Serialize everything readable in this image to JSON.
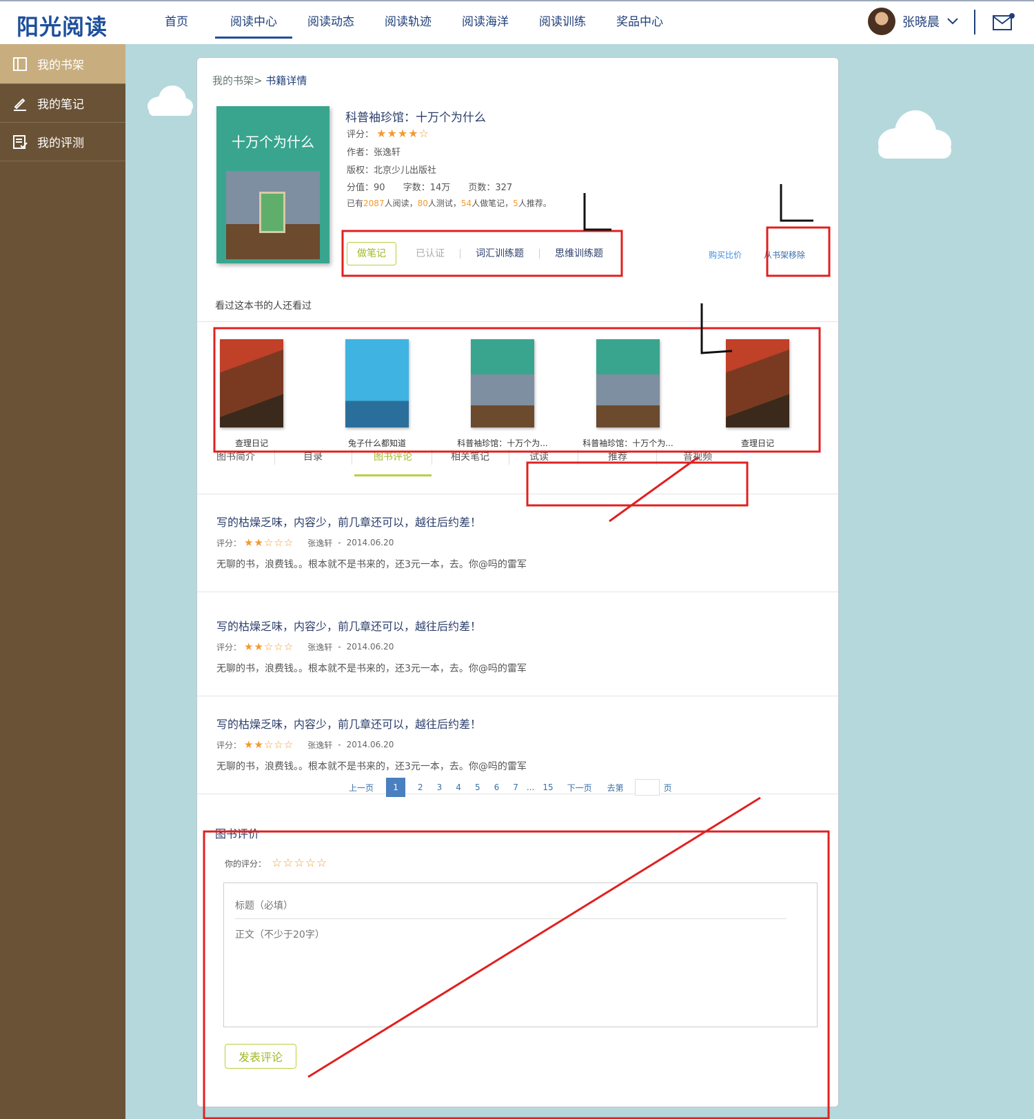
{
  "header": {
    "logo": "阳光阅读",
    "nav": [
      "首页",
      "阅读中心",
      "阅读动态",
      "阅读轨迹",
      "阅读海洋",
      "阅读训练",
      "奖品中心"
    ],
    "active_nav": "阅读中心",
    "user_name": "张晓晨"
  },
  "sidebar": {
    "items": [
      {
        "label": "我的书架",
        "icon": "bookshelf-icon"
      },
      {
        "label": "我的笔记",
        "icon": "pen-icon"
      },
      {
        "label": "我的评测",
        "icon": "checklist-icon"
      }
    ]
  },
  "breadcrumb": {
    "parent": "我的书架>",
    "current": "书籍详情"
  },
  "book": {
    "cover_title": "十万个为什么",
    "title": "科普袖珍馆：十万个为什么",
    "rating_label": "评分：",
    "rating": 4,
    "rating_max": 5,
    "author": "作者：张逸轩",
    "publisher": "版权：北京少儿出版社",
    "score": "分值：90",
    "words": "字数：14万",
    "pages": "页数：327",
    "stats": {
      "prefix": "已有",
      "readers": "2087",
      "readers_suffix": "人阅读，",
      "tested": "80",
      "tested_suffix": "人测试，",
      "notes": "54",
      "notes_suffix": "人做笔记，",
      "recommend": "5",
      "recommend_suffix": "人推荐。"
    },
    "actions": {
      "note": "做笔记",
      "certified": "已认证",
      "vocab": "词汇训练题",
      "thinking": "思维训练题",
      "buy": "购买比价",
      "remove": "从书架移除"
    }
  },
  "also_read": {
    "heading": "看过这本书的人还看过",
    "books": [
      {
        "label": "查理日记",
        "style": "diary"
      },
      {
        "label": "兔子什么都知道",
        "style": "rabbit"
      },
      {
        "label": "科普袖珍馆：十万个为...",
        "style": "sci"
      },
      {
        "label": "科普袖珍馆：十万个为...",
        "style": "sci"
      },
      {
        "label": "查理日记",
        "style": "diary"
      }
    ]
  },
  "tabs": [
    "图书简介",
    "目录",
    "图书评论",
    "相关笔记",
    "试读",
    "推荐",
    "音视频"
  ],
  "active_tab": "图书评论",
  "reviews": [
    {
      "title": "写的枯燥乏味，内容少，前几章还可以，越往后约差！",
      "rating_label": "评分：",
      "rating": 2,
      "author": "张逸轩",
      "sep": "-",
      "date": "2014.06.20",
      "body": "无聊的书，浪费钱。。根本就不是书来的，还3元一本，去。你@吗的雷军"
    },
    {
      "title": "写的枯燥乏味，内容少，前几章还可以，越往后约差！",
      "rating_label": "评分：",
      "rating": 2,
      "author": "张逸轩",
      "sep": "-",
      "date": "2014.06.20",
      "body": "无聊的书，浪费钱。。根本就不是书来的，还3元一本，去。你@吗的雷军"
    },
    {
      "title": "写的枯燥乏味，内容少，前几章还可以，越往后约差！",
      "rating_label": "评分：",
      "rating": 2,
      "author": "张逸轩",
      "sep": "-",
      "date": "2014.06.20",
      "body": "无聊的书，浪费钱。。根本就不是书来的，还3元一本，去。你@吗的雷军"
    }
  ],
  "pager": {
    "prev": "上一页",
    "pages": [
      "1",
      "2",
      "3",
      "4",
      "5",
      "6",
      "7"
    ],
    "ellipsis": "...",
    "last": "15",
    "next": "下一页",
    "goto_prefix": "去第",
    "goto_suffix": "页",
    "current": "1"
  },
  "review_form": {
    "heading": "图书评价",
    "your_score_label": "你的评分：",
    "title_placeholder": "标题（必填）",
    "body_placeholder": "正文（不少于20字）",
    "submit": "发表评论"
  },
  "colors": {
    "brand_blue": "#1d4f9b",
    "sidebar_bg": "#6a5236",
    "sidebar_active": "#c8ad7f",
    "accent_green": "#a2b824",
    "star_orange": "#f29a2e",
    "annotation_red": "#e02020",
    "page_bg": "#b5d8dc"
  }
}
